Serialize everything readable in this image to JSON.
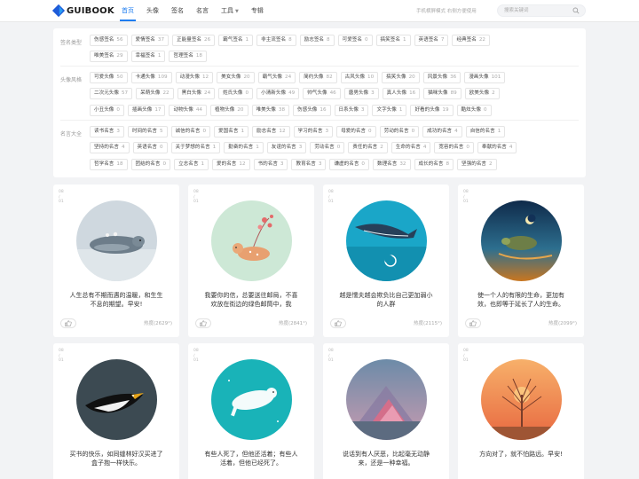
{
  "header": {
    "logo": "GUIBOOK",
    "nav": [
      {
        "label": "首页",
        "active": true
      },
      {
        "label": "头像"
      },
      {
        "label": "签名"
      },
      {
        "label": "名言"
      },
      {
        "label": "工具",
        "dropdown": true
      },
      {
        "label": "专辑"
      }
    ],
    "tip": "手机横屏模式 右侧方便使用",
    "search_placeholder": "搜索关键词"
  },
  "categories": [
    {
      "label": "签名类型",
      "lines": [
        [
          [
            "伤感签名",
            "56"
          ],
          [
            "爱情签名",
            "37"
          ],
          [
            "正能量签名",
            "26"
          ],
          [
            "霸气签名",
            "1"
          ],
          [
            "非主流签名",
            "8"
          ],
          [
            "励志签名",
            "8"
          ],
          [
            "可爱签名",
            "0"
          ],
          [
            "搞笑签名",
            "1"
          ],
          [
            "英语签名",
            "7"
          ],
          [
            "经典签名",
            "22"
          ]
        ],
        [
          [
            "唯美签名",
            "29"
          ],
          [
            "幸福签名",
            "1"
          ],
          [
            "哲理签名",
            "18"
          ]
        ]
      ]
    },
    {
      "label": "头像风格",
      "lines": [
        [
          [
            "可爱头像",
            "50"
          ],
          [
            "卡通头像",
            "109"
          ],
          [
            "动漫头像",
            "12"
          ],
          [
            "美女头像",
            "20"
          ],
          [
            "霸气头像",
            "24"
          ],
          [
            "简约头像",
            "82"
          ],
          [
            "古风头像",
            "10"
          ],
          [
            "搞笑头像",
            "20"
          ],
          [
            "风景头像",
            "36"
          ],
          [
            "漫画头像",
            "101"
          ]
        ],
        [
          [
            "二次元头像",
            "57"
          ],
          [
            "呆萌头像",
            "22"
          ],
          [
            "黑白头像",
            "24"
          ],
          [
            "姓氏头像",
            "0"
          ],
          [
            "小清新头像",
            "49"
          ],
          [
            "帅气头像",
            "46"
          ],
          [
            "唐男头像",
            "3"
          ],
          [
            "真人头像",
            "16"
          ],
          [
            "猫咪头像",
            "89"
          ],
          [
            "欧美头像",
            "2"
          ]
        ],
        [
          [
            "小丑头像",
            "0"
          ],
          [
            "插画头像",
            "17"
          ],
          [
            "动物头像",
            "44"
          ],
          [
            "植物头像",
            "20"
          ],
          [
            "唯美头像",
            "38"
          ],
          [
            "伤感头像",
            "16"
          ],
          [
            "日系头像",
            "3"
          ],
          [
            "文字头像",
            "1"
          ],
          [
            "好看的头像",
            "19"
          ],
          [
            "酷炫头像",
            "0"
          ]
        ]
      ]
    },
    {
      "label": "名言大全",
      "lines": [
        [
          [
            "读书名言",
            "3"
          ],
          [
            "时间的名言",
            "5"
          ],
          [
            "诚信的名言",
            "0"
          ],
          [
            "爱国名言",
            "1"
          ],
          [
            "励志名言",
            "12"
          ],
          [
            "学习的名言",
            "3"
          ],
          [
            "母爱的名言",
            "0"
          ],
          [
            "劳动的名言",
            "0"
          ],
          [
            "成功的名言",
            "4"
          ],
          [
            "自信的名言",
            "1"
          ]
        ],
        [
          [
            "坚持的名言",
            "4"
          ],
          [
            "英语名言",
            "0"
          ],
          [
            "关于梦想的名言",
            "1"
          ],
          [
            "勤奋的名言",
            "1"
          ],
          [
            "友谊的名言",
            "3"
          ],
          [
            "劳动名言",
            "0"
          ],
          [
            "责任的名言",
            "2"
          ],
          [
            "生命的名言",
            "4"
          ],
          [
            "宽容的名言",
            "0"
          ],
          [
            "奉献的名言",
            "4"
          ]
        ],
        [
          [
            "哲学名言",
            "18"
          ],
          [
            "团结的名言",
            "0"
          ],
          [
            "立志名言",
            "1"
          ],
          [
            "爱的名言",
            "12"
          ],
          [
            "书的名言",
            "3"
          ],
          [
            "教育名言",
            "3"
          ],
          [
            "谦虚的名言",
            "0"
          ],
          [
            "数理名言",
            "32"
          ],
          [
            "成长的名言",
            "8"
          ],
          [
            "坚强的名言",
            "2"
          ]
        ]
      ]
    }
  ],
  "cards": [
    {
      "date": [
        "08",
        "",
        "01"
      ],
      "scene": "seal",
      "text": "人生总有不期而遇的温暖，和生生不息的期望。早安!",
      "heat": "热度(2629°)"
    },
    {
      "date": [
        "08",
        "",
        "01"
      ],
      "scene": "fawn",
      "text": "我要你的信，总要送往邮局，不喜欢放在街边的绿色邮筒中，我",
      "heat": "热度(2841°)"
    },
    {
      "date": [
        "08",
        "",
        "01"
      ],
      "scene": "whale",
      "text": "越是懦夫越会欺负比自己更加弱小的人群",
      "heat": "热度(2115°)"
    },
    {
      "date": [
        "08",
        "",
        "01"
      ],
      "scene": "turtle",
      "text": "使一个人的有限的生命，更加有效，也即等于延长了人的生命。",
      "heat": "热度(2099°)"
    },
    {
      "date": [
        "08",
        "",
        "01"
      ],
      "scene": "penguin",
      "text": "买书的快乐，如同缝林好汉买进了盒子抱一样快乐。",
      "heat": ""
    },
    {
      "date": [
        "08",
        "",
        "01"
      ],
      "scene": "bear",
      "text": "有些人死了，但他还活着；有些人活着，但他已经死了。",
      "heat": ""
    },
    {
      "date": [
        "08",
        "",
        "01"
      ],
      "scene": "mountain",
      "text": "说话到有人厌恶，比起毫无动静来，还是一种幸福。",
      "heat": ""
    },
    {
      "date": [
        "08",
        "",
        "01"
      ],
      "scene": "tree",
      "text": "方向对了，就不怕路远。早安!",
      "heat": ""
    }
  ],
  "colors": {
    "accent": "#1e7df0",
    "background": "#f2f3f5"
  }
}
